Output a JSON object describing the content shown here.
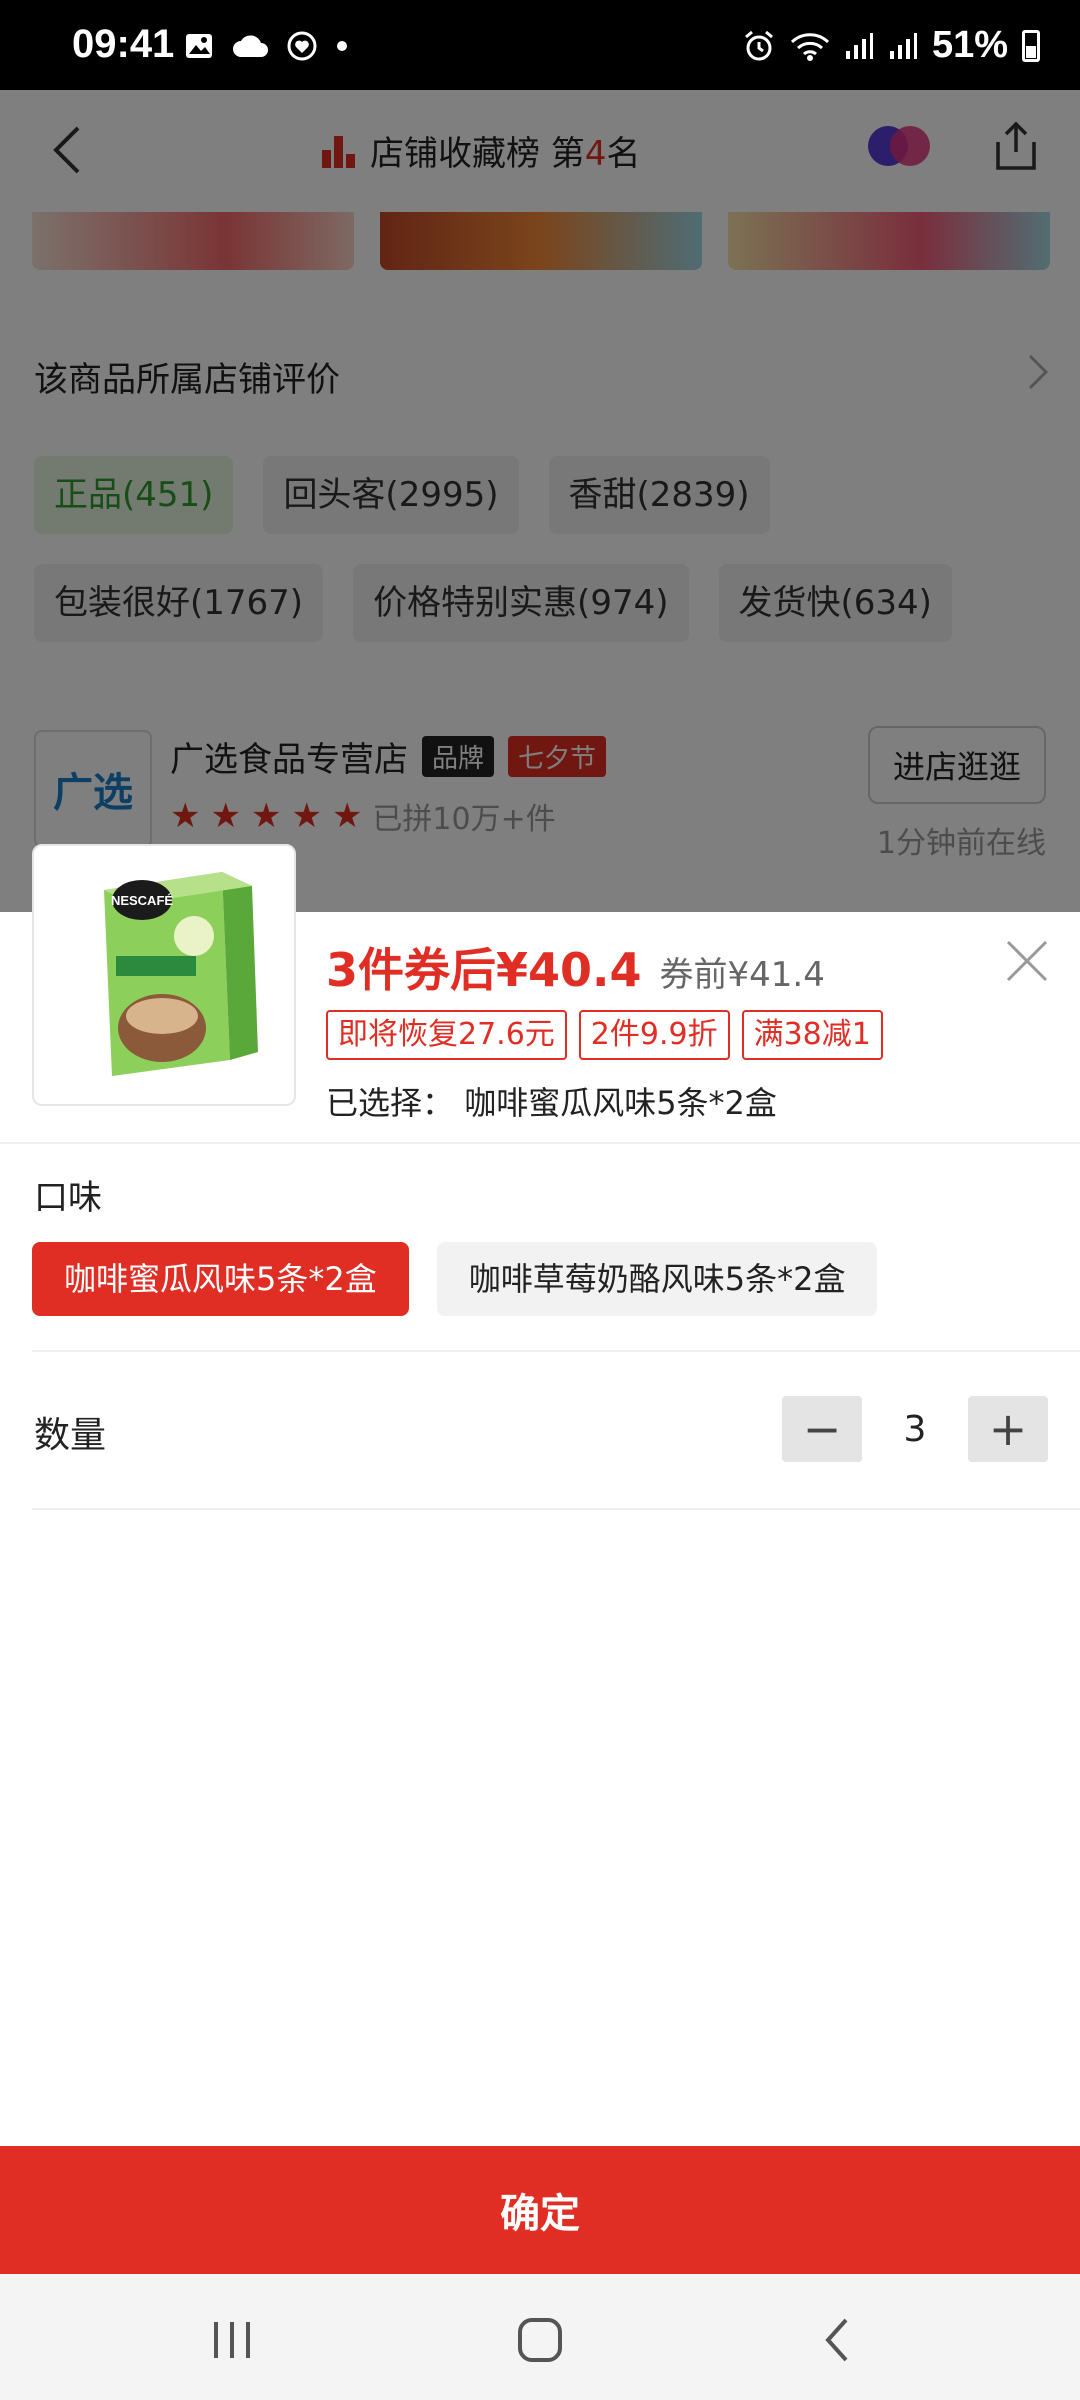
{
  "status_bar": {
    "time": "09:41",
    "battery": "51%"
  },
  "background_page": {
    "rank_text": "店铺收藏榜 第",
    "rank_number": "4",
    "rank_suffix": "名",
    "section_title": "该商品所属店铺评价",
    "tags": [
      "正品(451)",
      "回头客(2995)",
      "香甜(2839)",
      "包装很好(1767)",
      "价格特别实惠(974)",
      "发货快(634)"
    ],
    "store": {
      "logo_text": "广选",
      "name": "广选食品专营店",
      "brand_badge": "品牌",
      "festival_badge": "七夕节",
      "sold": "已拼10万+件",
      "visit_button": "进店逛逛",
      "online": "1分钟前在线"
    }
  },
  "sheet": {
    "price_main": "3件券后¥40.4",
    "price_before": "券前¥41.4",
    "promos": [
      "即将恢复27.6元",
      "2件9.9折",
      "满38减1"
    ],
    "selected_label": "已选择：",
    "selected_value": "咖啡蜜瓜风味5条*2盒",
    "flavor_label": "口味",
    "options": [
      "咖啡蜜瓜风味5条*2盒",
      "咖啡草莓奶酪风味5条*2盒"
    ],
    "quantity_label": "数量",
    "quantity": "3",
    "minus": "−",
    "plus": "+",
    "product_brand": "NESCAFÉ"
  },
  "confirm_label": "确定",
  "colors": {
    "accent": "#e02e24"
  }
}
